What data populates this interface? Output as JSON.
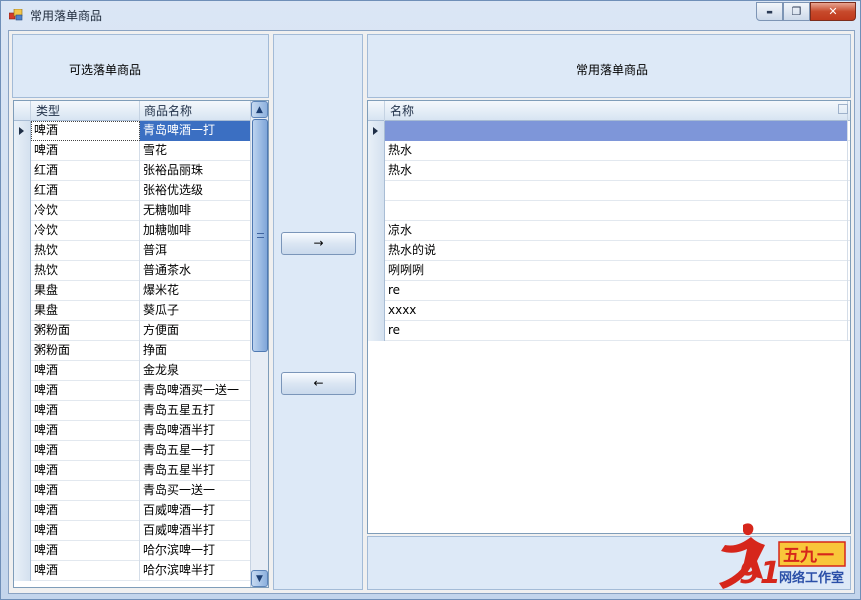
{
  "window": {
    "title": "常用落单商品",
    "minimize_glyph": "▬",
    "restore_glyph": "❐",
    "close_glyph": "✕"
  },
  "left_panel": {
    "title": "可选落单商品",
    "columns": [
      "类型",
      "商品名称"
    ],
    "rows": [
      {
        "type": "啤酒",
        "name": "青岛啤酒一打",
        "selected": true
      },
      {
        "type": "啤酒",
        "name": "雪花"
      },
      {
        "type": "红酒",
        "name": "张裕品丽珠"
      },
      {
        "type": "红酒",
        "name": "张裕优选级"
      },
      {
        "type": "冷饮",
        "name": "无糖咖啡"
      },
      {
        "type": "冷饮",
        "name": "加糖咖啡"
      },
      {
        "type": "热饮",
        "name": "普洱"
      },
      {
        "type": "热饮",
        "name": "普通茶水"
      },
      {
        "type": "果盘",
        "name": "爆米花"
      },
      {
        "type": "果盘",
        "name": "葵瓜子"
      },
      {
        "type": "粥粉面",
        "name": "方便面"
      },
      {
        "type": "粥粉面",
        "name": "挣面"
      },
      {
        "type": "啤酒",
        "name": "金龙泉"
      },
      {
        "type": "啤酒",
        "name": "青岛啤酒买一送一"
      },
      {
        "type": "啤酒",
        "name": "青岛五星五打"
      },
      {
        "type": "啤酒",
        "name": "青岛啤酒半打"
      },
      {
        "type": "啤酒",
        "name": "青岛五星一打"
      },
      {
        "type": "啤酒",
        "name": "青岛五星半打"
      },
      {
        "type": "啤酒",
        "name": "青岛买一送一"
      },
      {
        "type": "啤酒",
        "name": "百威啤酒一打"
      },
      {
        "type": "啤酒",
        "name": "百威啤酒半打"
      },
      {
        "type": "啤酒",
        "name": "哈尔滨啤一打"
      },
      {
        "type": "啤酒",
        "name": "哈尔滨啤半打"
      }
    ],
    "scroll_up_glyph": "▲",
    "scroll_down_glyph": "▼"
  },
  "buttons": {
    "add_label": "→",
    "remove_label": "←"
  },
  "right_panel": {
    "title": "常用落单商品",
    "columns": [
      "名称"
    ],
    "rows": [
      {
        "name": "",
        "selected": true
      },
      {
        "name": "热水"
      },
      {
        "name": "热水"
      },
      {
        "name": ""
      },
      {
        "name": ""
      },
      {
        "name": "凉水"
      },
      {
        "name": "热水的说"
      },
      {
        "name": "咧咧咧"
      },
      {
        "name": "re"
      },
      {
        "name": "xxxx"
      },
      {
        "name": "re"
      }
    ]
  },
  "watermark": {
    "number": "91",
    "brand": "五九一",
    "subtitle": "网络工作室"
  },
  "colors": {
    "selection": "#3b6fc2",
    "selection_right": "#7e96d9",
    "panel_bg": "#dde9f7"
  }
}
